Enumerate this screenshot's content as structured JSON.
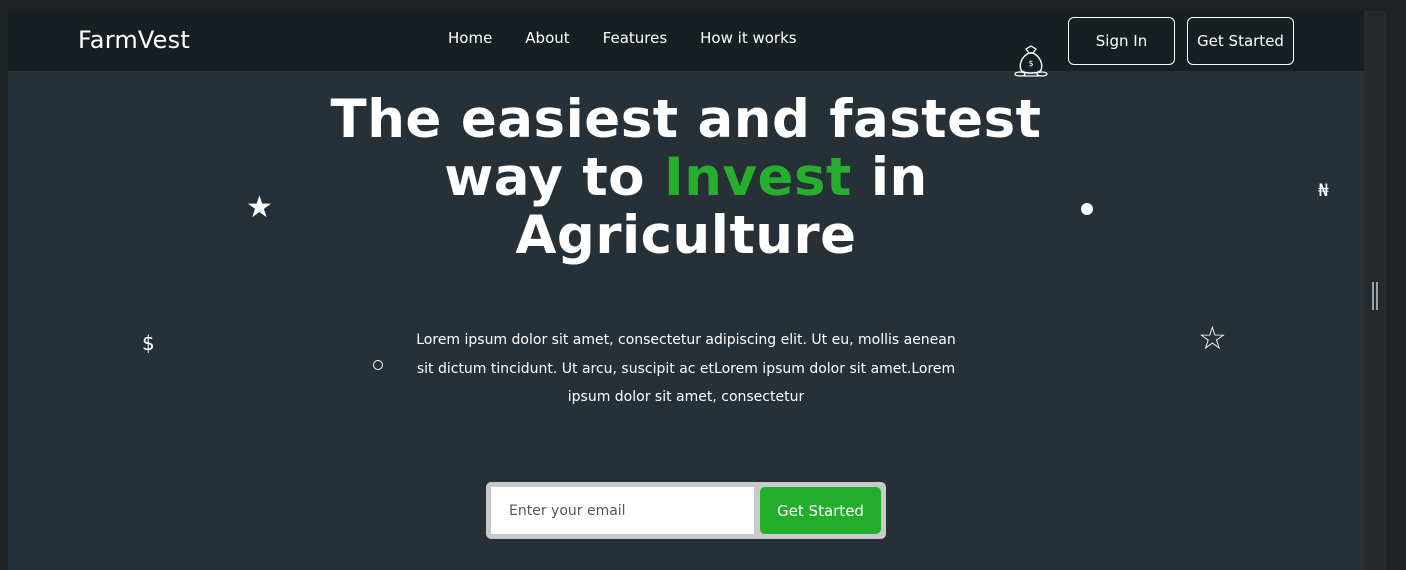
{
  "brand": {
    "name": "FarmVest"
  },
  "nav": {
    "links": [
      "Home",
      "About",
      "Features",
      "How it works"
    ],
    "sign_in": "Sign In",
    "get_started": "Get Started"
  },
  "hero": {
    "title_line1": "The easiest and fastest",
    "title_pre": "way to ",
    "title_accent": "Invest",
    "title_post": " in",
    "title_line3": "Agriculture",
    "description": "Lorem ipsum dolor sit amet, consectetur adipiscing elit. Ut eu, mollis aenean sit dictum tincidunt. Ut arcu, suscipit ac etLorem ipsum dolor sit amet.Lorem ipsum dolor sit amet, consectetur"
  },
  "signup": {
    "email_placeholder": "Enter your email",
    "button_label": "Get Started"
  },
  "decorations": {
    "star_filled": "★",
    "star_outline": "☆",
    "dollar": "$",
    "naira": "₦"
  },
  "colors": {
    "accent": "#27ae2f",
    "background": "#273036",
    "navbar": "#181f23"
  }
}
